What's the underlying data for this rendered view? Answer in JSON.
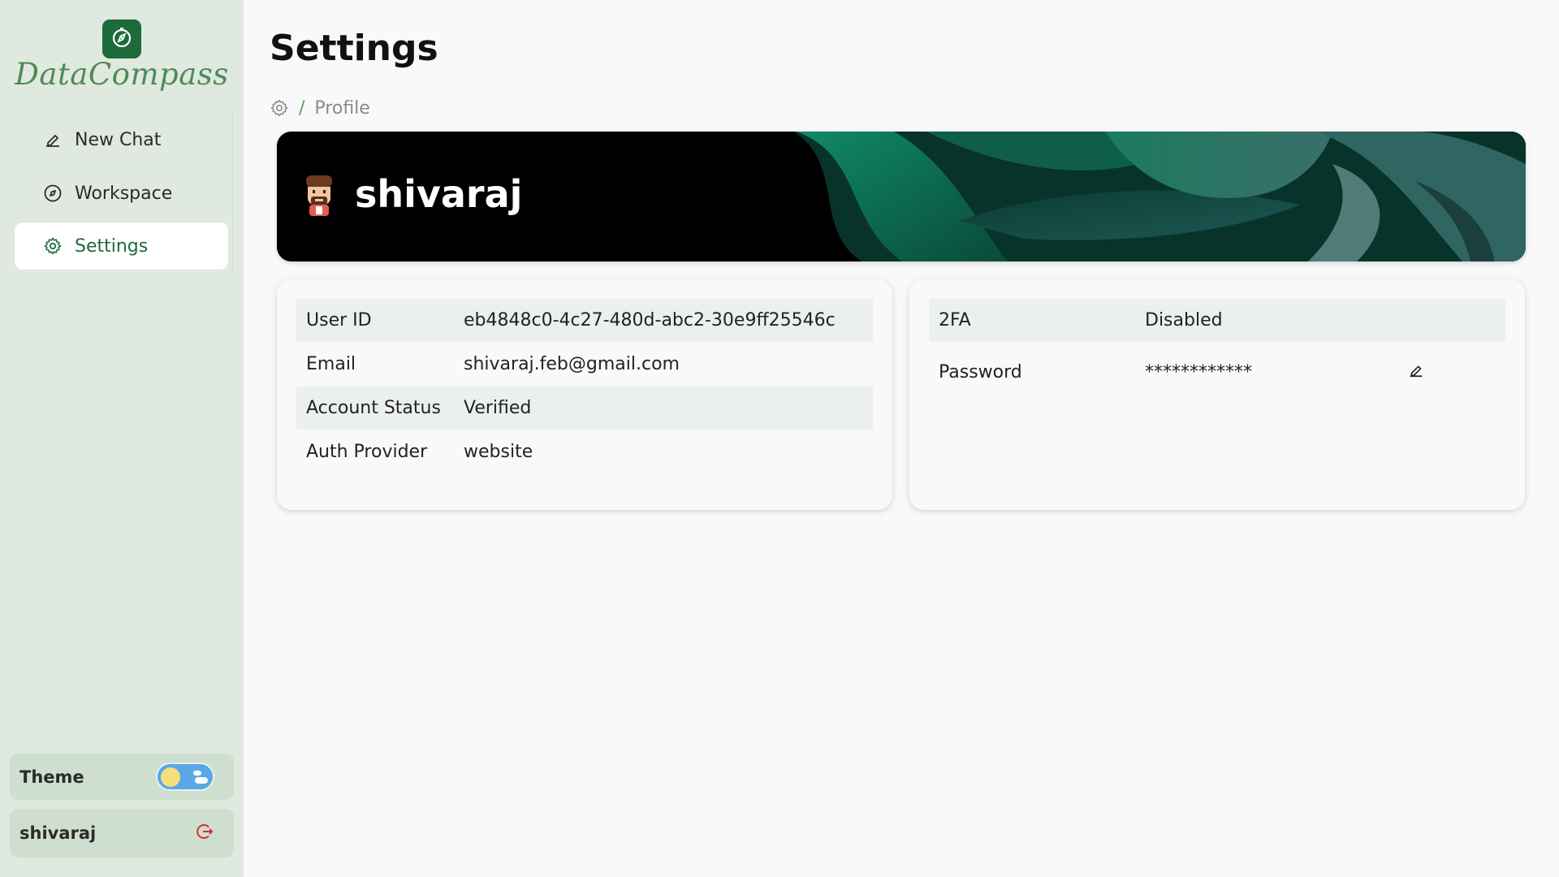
{
  "app": {
    "name": "DataCompass"
  },
  "sidebar": {
    "items": [
      {
        "label": "New Chat",
        "icon": "pencil-icon"
      },
      {
        "label": "Workspace",
        "icon": "compass-icon"
      },
      {
        "label": "Settings",
        "icon": "gear-icon",
        "active": true
      }
    ],
    "theme": {
      "label": "Theme",
      "mode": "light"
    },
    "user": {
      "name": "shivaraj"
    }
  },
  "page": {
    "title": "Settings",
    "breadcrumb": {
      "separator": "/",
      "current": "Profile"
    }
  },
  "profile": {
    "display_name": "shivaraj"
  },
  "account_info": [
    {
      "label": "User ID",
      "value": "eb4848c0-4c27-480d-abc2-30e9ff25546c"
    },
    {
      "label": "Email",
      "value": "shivaraj.feb@gmail.com"
    },
    {
      "label": "Account Status",
      "value": "Verified"
    },
    {
      "label": "Auth Provider",
      "value": "website"
    }
  ],
  "security": [
    {
      "label": "2FA",
      "value": "Disabled"
    },
    {
      "label": "Password",
      "value": "************"
    }
  ],
  "colors": {
    "brand": "#1d6b3a",
    "sidebar_bg": "#dfe9df",
    "logout": "#d32f2f"
  }
}
